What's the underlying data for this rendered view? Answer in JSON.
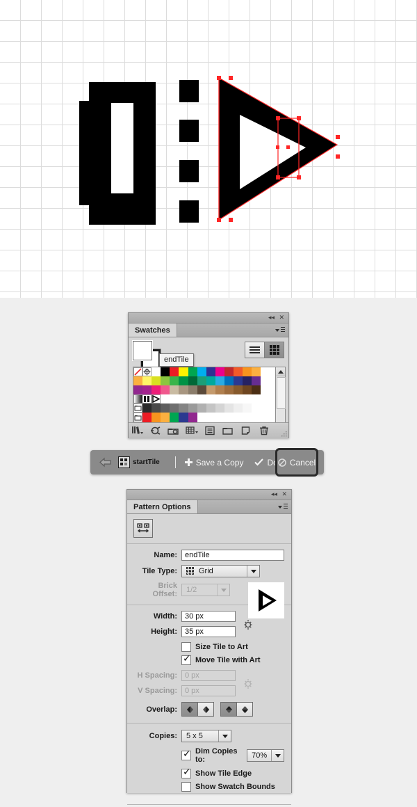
{
  "artboard": {
    "grid_size_px": 30,
    "grid_color": "#dcdcdc",
    "background": "#ffffff",
    "artwork_fill": "#000000",
    "selection_color": "#ff2626",
    "description": "Pattern tile artwork: a thick bracket glyph, dotted column, and a selected triangular play arrow with a narrow rectangle selection"
  },
  "swatches_panel": {
    "title": "Swatches",
    "collapse_icon": "collapse-icon",
    "close_icon": "close-icon",
    "flyout_icon": "panel-menu-icon",
    "view_list_icon": "list-view-icon",
    "view_grid_icon": "grid-view-icon",
    "fill_color": "#ffffff",
    "stroke_color": "#ffffff",
    "tooltip": "endTile",
    "swatch_rows": [
      [
        "none",
        "registration",
        "#ffffff",
        "#000000",
        "#ed1c24",
        "#fff200",
        "#00a651",
        "#00aeef",
        "#2e3192",
        "#ec008c",
        "#c1272d",
        "#f15a29",
        "#f7941e",
        "#fbb040"
      ],
      [
        "#fbb040",
        "#fff568",
        "#d9e021",
        "#8cc63f",
        "#39b54a",
        "#009245",
        "#006837",
        "#1c9e77",
        "#00a99d",
        "#29abe2",
        "#0071bc",
        "#2b3990",
        "#262262",
        "#662d91"
      ],
      [
        "#92278f",
        "#a3238e",
        "#ed1e79",
        "#f0588d",
        "#c9bba2",
        "#a89680",
        "#8b7d6b",
        "#5b4a3a",
        "#c49a6c",
        "#b07f4e",
        "#9c6b3c",
        "#875a2c",
        "#6e4520",
        "#4b2e14"
      ],
      [
        "gradient-swatch",
        "pattern-start-tile",
        "pattern-end-tile",
        "",
        "",
        "",
        "",
        "",
        "",
        "",
        "",
        "",
        "",
        ""
      ],
      [
        "folder",
        "#2b2b2b",
        "#4a4a4a",
        "#5e5e5e",
        "#6f6f6f",
        "#848484",
        "#9a9a9a",
        "#b0b0b0",
        "#c4c4c4",
        "#d4d4d4",
        "#e4e4e4",
        "#efefef",
        "#f7f7f7",
        "#ffffff"
      ],
      [
        "folder",
        "#ed1c24",
        "#f7941e",
        "#fbb040",
        "#00a651",
        "#2b3990",
        "#92278f",
        "",
        "",
        "",
        "",
        "",
        "",
        ""
      ]
    ],
    "footer_buttons": [
      "swatch-libraries-icon",
      "show-swatch-kinds-icon",
      "color-group-options-icon",
      "new-color-group-icon",
      "swatch-options-icon",
      "new-folder-icon",
      "new-swatch-icon",
      "delete-swatch-icon"
    ]
  },
  "pattern_toolbar": {
    "back_icon": "back-arrow-icon",
    "tile_icon": "pattern-tile-icon",
    "tile_name": "startTile",
    "save_copy_label": "Save a Copy",
    "save_copy_icon": "plus-icon",
    "done_label": "Done",
    "done_icon": "check-icon",
    "cancel_label": "Cancel",
    "cancel_icon": "no-entry-icon",
    "background": "#8a8a8a"
  },
  "pattern_options": {
    "title": "Pattern Options",
    "collapse_icon": "collapse-icon",
    "close_icon": "close-icon",
    "flyout_icon": "panel-menu-icon",
    "tool_button_icon": "pattern-tile-tool-icon",
    "name_label": "Name:",
    "name_value": "endTile",
    "tile_type_label": "Tile Type:",
    "tile_type_value": "Grid",
    "tile_type_icon": "grid-icon",
    "brick_offset_label": "Brick Offset:",
    "brick_offset_value": "1/2",
    "width_label": "Width:",
    "width_value": "30 px",
    "height_label": "Height:",
    "height_value": "35 px",
    "dimension_link_icon": "unlinked-proportions-icon",
    "size_tile_to_art_label": "Size Tile to Art",
    "size_tile_to_art_checked": false,
    "move_tile_with_art_label": "Move Tile with Art",
    "move_tile_with_art_checked": true,
    "h_spacing_label": "H Spacing:",
    "h_spacing_value": "0 px",
    "v_spacing_label": "V Spacing:",
    "v_spacing_value": "0 px",
    "spacing_link_icon": "unlinked-proportions-icon",
    "overlap_label": "Overlap:",
    "overlap_buttons": [
      {
        "name": "overlap-left-in-front",
        "selected": true
      },
      {
        "name": "overlap-right-in-front",
        "selected": false
      },
      {
        "name": "overlap-top-in-front",
        "selected": true
      },
      {
        "name": "overlap-bottom-in-front",
        "selected": false
      }
    ],
    "copies_label": "Copies:",
    "copies_value": "5 x 5",
    "dim_copies_label": "Dim Copies to:",
    "dim_copies_checked": true,
    "dim_copies_value": "70%",
    "show_tile_edge_label": "Show Tile Edge",
    "show_tile_edge_checked": true,
    "show_swatch_bounds_label": "Show Swatch Bounds",
    "show_swatch_bounds_checked": false,
    "preview_icon": "play-arrow-tile-preview"
  }
}
